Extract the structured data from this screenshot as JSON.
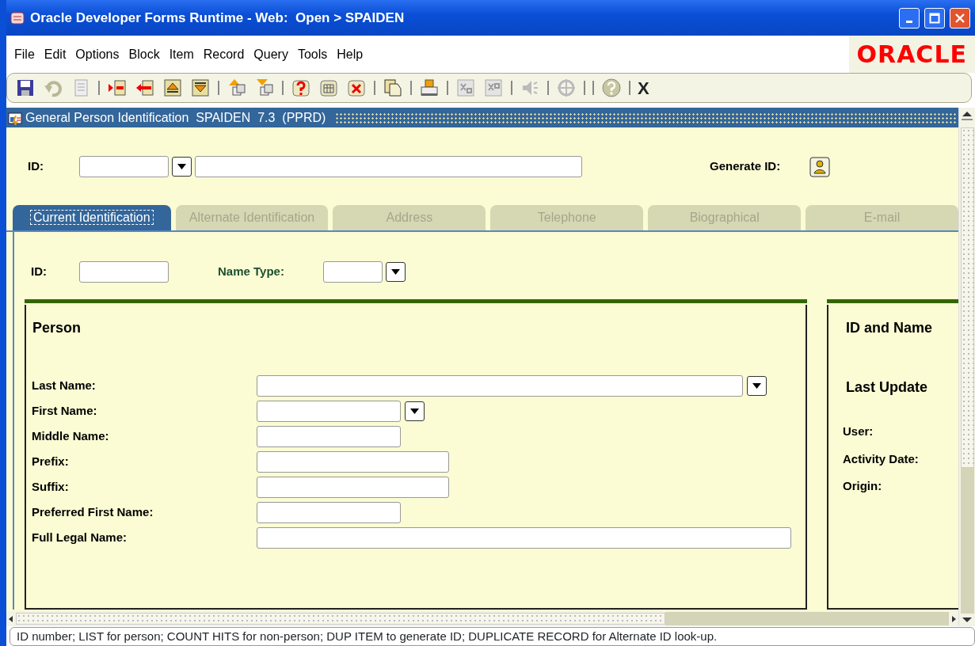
{
  "window": {
    "title": "Oracle Developer Forms Runtime - Web:  Open > SPAIDEN"
  },
  "menu": [
    "File",
    "Edit",
    "Options",
    "Block",
    "Item",
    "Record",
    "Query",
    "Tools",
    "Help"
  ],
  "logo": "ORACLE",
  "toolbar": {
    "exit_label": "X"
  },
  "form": {
    "title": "General Person Identification  SPAIDEN  7.3  (PPRD)",
    "key_block": {
      "id_label": "ID:",
      "generate_label": "Generate ID:"
    },
    "tabs": [
      {
        "label": "Current Identification",
        "selected": true
      },
      {
        "label": "Alternate Identification",
        "selected": false
      },
      {
        "label": "Address",
        "selected": false
      },
      {
        "label": "Telephone",
        "selected": false
      },
      {
        "label": "Biographical",
        "selected": false
      },
      {
        "label": "E-mail",
        "selected": false
      }
    ],
    "id_label": "ID:",
    "name_type_label": "Name Type:",
    "person": {
      "title": "Person",
      "fields": [
        {
          "label": "Last Name:",
          "dropdown": true
        },
        {
          "label": "First Name:",
          "dropdown": true
        },
        {
          "label": "Middle Name:",
          "dropdown": false
        },
        {
          "label": "Prefix:",
          "dropdown": false
        },
        {
          "label": "Suffix:",
          "dropdown": false
        },
        {
          "label": "Preferred First Name:",
          "dropdown": false
        },
        {
          "label": "Full Legal Name:",
          "dropdown": false
        }
      ]
    },
    "id_name": {
      "title": "ID and Name",
      "subtitle": "Last Update",
      "labels": [
        "User:",
        "Activity Date:",
        "Origin:"
      ]
    }
  },
  "status_bar": "ID number; LIST for person; COUNT HITS for non-person; DUP ITEM to generate ID; DUPLICATE RECORD for Alternate ID look-up."
}
